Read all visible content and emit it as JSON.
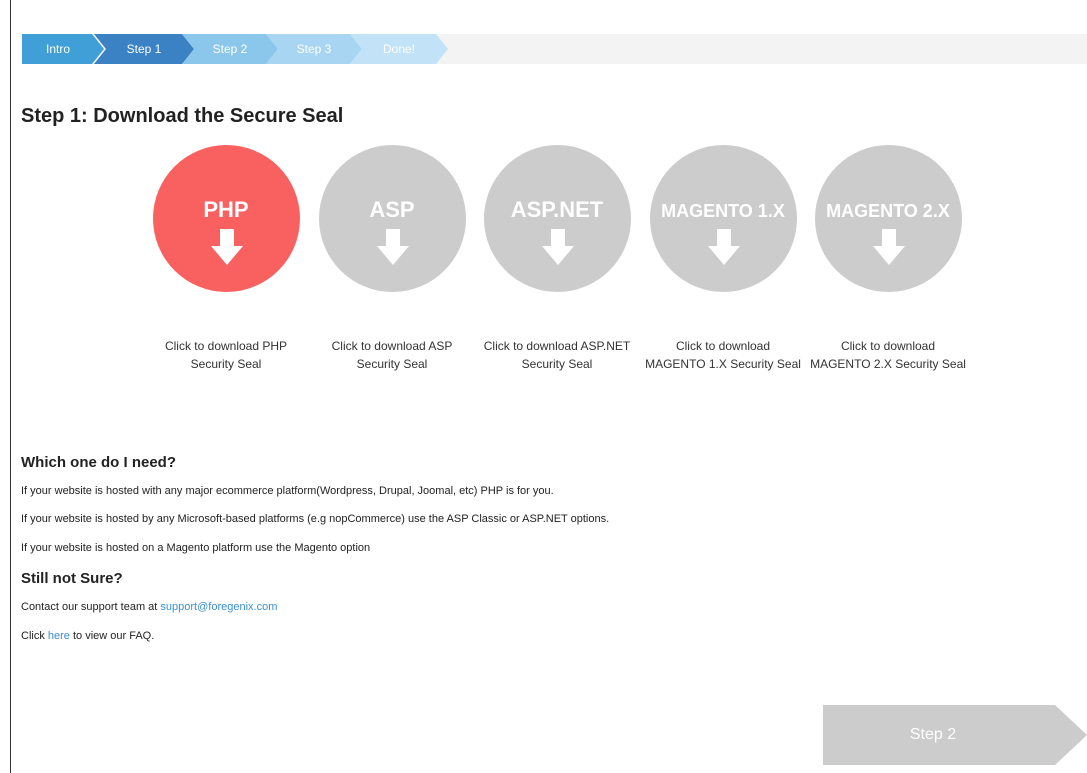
{
  "breadcrumb": {
    "steps": [
      {
        "label": "Intro"
      },
      {
        "label": "Step 1"
      },
      {
        "label": "Step 2"
      },
      {
        "label": "Step 3"
      },
      {
        "label": "Done!"
      }
    ],
    "colors": {
      "intro": "#3f9fd6",
      "current": "#3a82c3",
      "upcoming": "#8bc7ea"
    }
  },
  "page": {
    "title": "Step 1: Download the Secure Seal"
  },
  "options": [
    {
      "label": "PHP",
      "caption": "Click to download PHP Security Seal",
      "icon": "download-arrow-icon",
      "active": true
    },
    {
      "label": "ASP",
      "caption": "Click to download ASP Security Seal",
      "icon": "download-arrow-icon",
      "active": false
    },
    {
      "label": "ASP.NET",
      "caption": "Click to download ASP.NET Security Seal",
      "icon": "download-arrow-icon",
      "active": false
    },
    {
      "label": "MAGENTO 1.X",
      "caption": "Click to download MAGENTO 1.X Security Seal",
      "icon": "download-arrow-icon",
      "active": false
    },
    {
      "label": "MAGENTO 2.X",
      "caption": "Click to download MAGENTO 2.X Security Seal",
      "icon": "download-arrow-icon",
      "active": false
    }
  ],
  "colors": {
    "active": "#f96161",
    "inactive": "#cccccc",
    "link": "#3a8fd0"
  },
  "help": {
    "heading": "Which one do I need?",
    "lines": [
      "If your website is hosted with any major ecommerce platform(Wordpress, Drupal, Joomal, etc) PHP is for you.",
      "If your website is hosted by any Microsoft-based platforms (e.g nopCommerce) use the ASP Classic or ASP.NET options.",
      "If your website is hosted on a Magento platform use the Magento option"
    ]
  },
  "support": {
    "heading": "Still not Sure?",
    "contact_prefix": "Contact our support team at ",
    "email": "support@foregenix.com",
    "faq_prefix": "Click ",
    "faq_link": "here",
    "faq_suffix": " to view our FAQ."
  },
  "next_button": {
    "label": "Step 2"
  }
}
